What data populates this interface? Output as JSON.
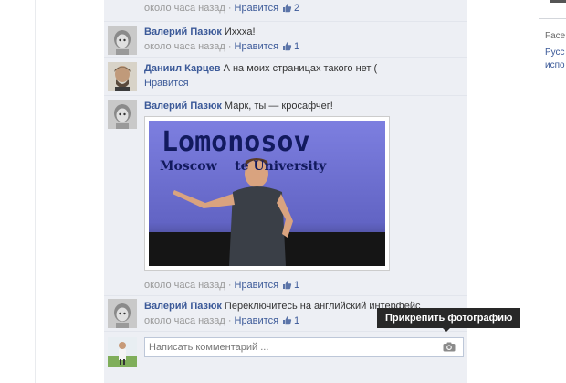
{
  "comments": [
    {
      "author": "",
      "text": "",
      "time": "около часа назад",
      "like_label": "Нравится",
      "likes": "2"
    },
    {
      "author": "Валерий Пазюк",
      "text": "Ихххa!",
      "time": "около часа назад",
      "like_label": "Нравится",
      "likes": "1"
    },
    {
      "author": "Даниил Карцев",
      "text": "А на моих страницах такого нет (",
      "time": "",
      "like_label": "Нравится",
      "likes": ""
    },
    {
      "author": "Валерий Пазюк",
      "text": "Марк, ты — кросафчег!",
      "time": "около часа назад",
      "like_label": "Нравится",
      "likes": "1",
      "photo": {
        "line1": "Lomonosov",
        "line2": "Moscow    te University"
      }
    },
    {
      "author": "Валерий Пазюк",
      "text": "Переключитесь на английский интерфейс",
      "time": "около часа назад",
      "like_label": "Нравится",
      "likes": "1"
    }
  ],
  "composer": {
    "placeholder": "Написать комментарий ...",
    "camera_icon": "camera-icon"
  },
  "tooltip": {
    "text": "Прикрепить фотографию"
  },
  "sidebar": {
    "line1": "Face",
    "line2": "Русс",
    "line3": "испо"
  },
  "colors": {
    "link": "#3b5998",
    "feed_bg": "#edeff4",
    "tooltip_bg": "#282828"
  }
}
